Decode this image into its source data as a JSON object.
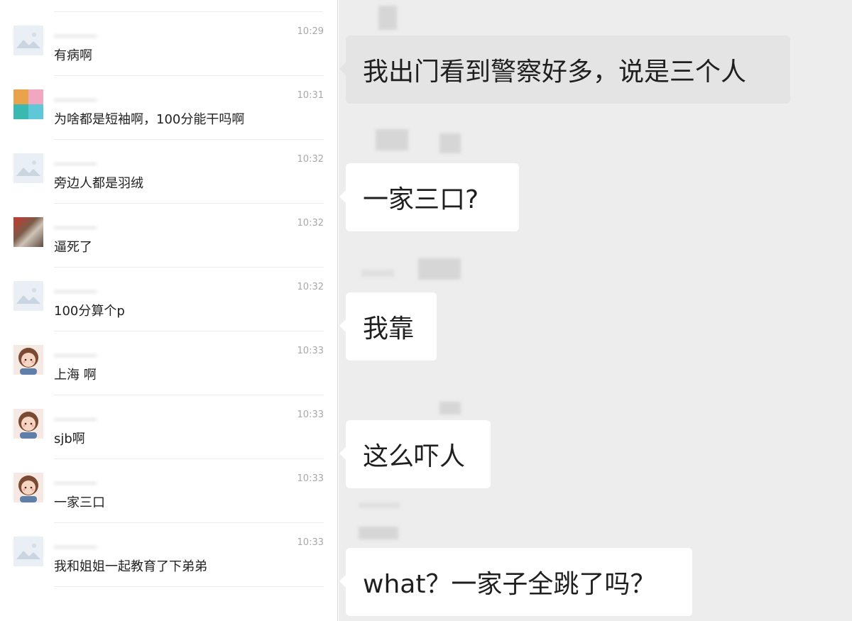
{
  "comments": [
    {
      "time": "10:29",
      "text": "有病啊",
      "avatar": "placeholder-avatar"
    },
    {
      "time": "10:31",
      "text": "为啥都是短袖啊，100分能干吗啊",
      "avatar": "grid-avatar"
    },
    {
      "time": "10:32",
      "text": "旁边人都是羽绒",
      "avatar": "placeholder-avatar"
    },
    {
      "time": "10:32",
      "text": "逼死了",
      "avatar": "photo-avatar"
    },
    {
      "time": "10:32",
      "text": "100分算个p",
      "avatar": "placeholder-avatar"
    },
    {
      "time": "10:33",
      "text": "上海 啊",
      "avatar": "cartoon-girl-avatar"
    },
    {
      "time": "10:33",
      "text": "sjb啊",
      "avatar": "cartoon-girl-avatar"
    },
    {
      "time": "10:33",
      "text": "一家三口",
      "avatar": "cartoon-girl-avatar"
    },
    {
      "time": "10:33",
      "text": "我和姐姐一起教育了下弟弟",
      "avatar": "placeholder-avatar"
    }
  ],
  "chat": {
    "messages": [
      {
        "text": "我出门看到警察好多，说是三个人"
      },
      {
        "text": "一家三口?"
      },
      {
        "text": "我靠"
      },
      {
        "text": "这么吓人"
      },
      {
        "text": "what？一家子全跳了吗？"
      }
    ]
  },
  "colors": {
    "chat_background": "#ededed",
    "bubble": "#ffffff",
    "bubble_highlight": "#e4e4e4",
    "timestamp": "#a8a8a8"
  }
}
